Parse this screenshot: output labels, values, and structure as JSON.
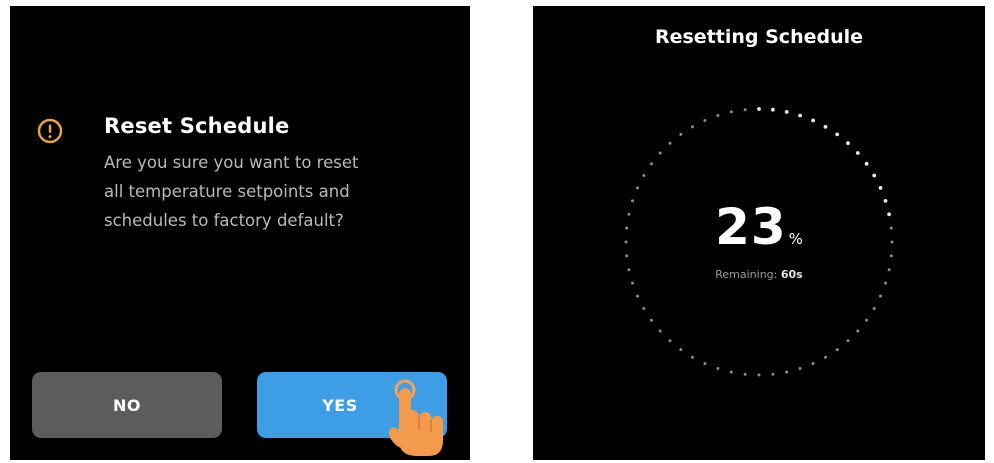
{
  "dialog": {
    "icon": "warning-icon",
    "accent_color": "#e8a640",
    "title": "Reset Schedule",
    "message_lines": [
      "Are you sure you want to reset",
      "all temperature setpoints and",
      "schedules to factory default?"
    ],
    "no_label": "NO",
    "yes_label": "YES",
    "no_color": "#5c5c5c",
    "yes_color": "#3d9ee6"
  },
  "progress": {
    "title": "Resetting Schedule",
    "percent": 23,
    "percent_text": "23",
    "unit": "%",
    "remaining_label": "Remaining:",
    "remaining_value": "60s"
  }
}
